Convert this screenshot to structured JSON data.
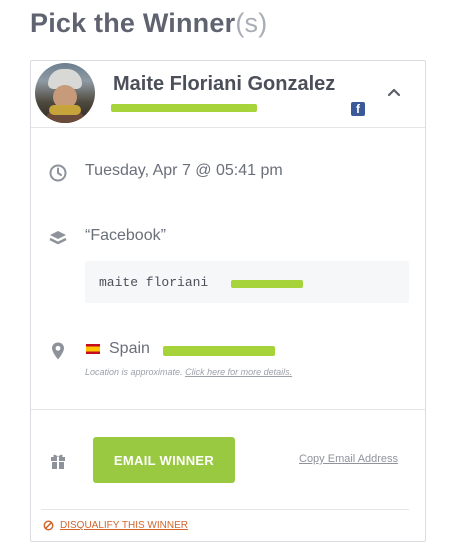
{
  "page": {
    "title": "Pick the Winner",
    "title_suffix": "(s)"
  },
  "winner": {
    "name": "Maite Floriani Gonzalez",
    "social_icon": "facebook-icon",
    "datetime": "Tuesday, Apr 7 @ 05:41 pm",
    "platform": "“Facebook”",
    "entry_text": "maite floriani",
    "country": "Spain",
    "location_note": "Location is approximate.",
    "location_link": "Click here for more details."
  },
  "actions": {
    "email_winner": "EMAIL WINNER",
    "copy_email": "Copy Email Address",
    "disqualify": "DISQUALIFY THIS WINNER"
  },
  "colors": {
    "accent_green": "#98c940",
    "redaction_green": "#a6d23a",
    "facebook_blue": "#3b5998",
    "disqualify_orange": "#d0662d"
  },
  "icons": [
    "clock-icon",
    "layers-icon",
    "map-pin-icon",
    "spain-flag-icon",
    "gift-icon",
    "chevron-up-icon",
    "ban-icon"
  ]
}
